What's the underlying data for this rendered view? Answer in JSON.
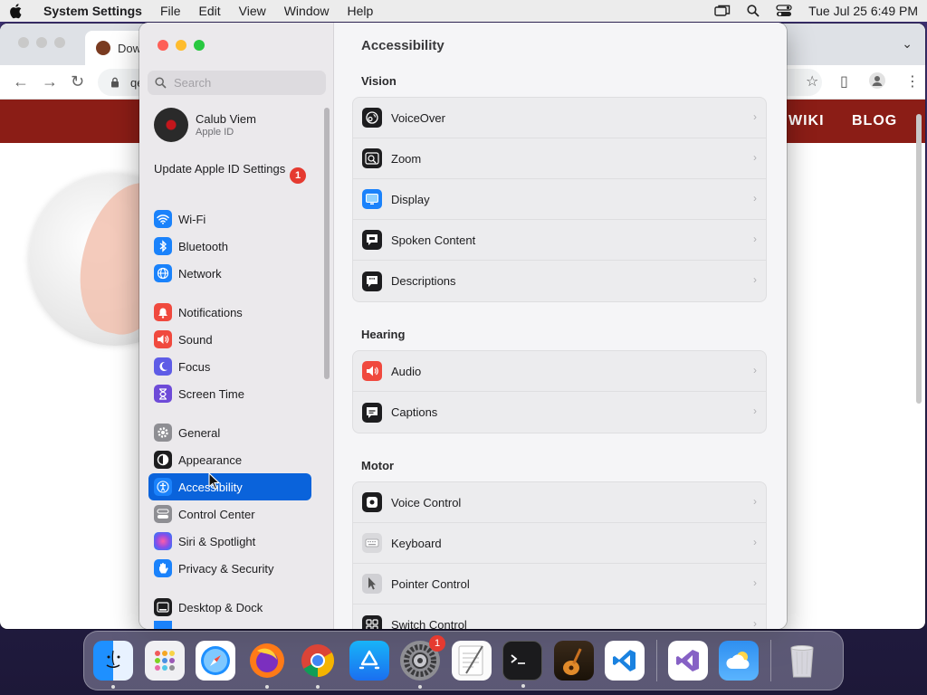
{
  "menubar": {
    "app_name": "System Settings",
    "menus": [
      "File",
      "Edit",
      "View",
      "Window",
      "Help"
    ],
    "clock": "Tue Jul 25  6:49 PM"
  },
  "browser": {
    "tab_title": "Dow",
    "url": "qe",
    "nav_links": [
      "WIKI",
      "BLOG"
    ]
  },
  "sidebar": {
    "search_placeholder": "Search",
    "user": {
      "name": "Calub Viem",
      "subtitle": "Apple ID"
    },
    "update": {
      "label": "Update Apple ID Settings",
      "badge": "1"
    },
    "items": [
      {
        "label": "Wi-Fi",
        "icon": "wifi-icon",
        "color": "#1a82fb"
      },
      {
        "label": "Bluetooth",
        "icon": "bluetooth-icon",
        "color": "#1a82fb"
      },
      {
        "label": "Network",
        "icon": "network-icon",
        "color": "#1a82fb"
      },
      {
        "label": "Notifications",
        "icon": "bell-icon",
        "color": "#f0493e"
      },
      {
        "label": "Sound",
        "icon": "speaker-icon",
        "color": "#f0493e"
      },
      {
        "label": "Focus",
        "icon": "moon-icon",
        "color": "#5e5ce6"
      },
      {
        "label": "Screen Time",
        "icon": "hourglass-icon",
        "color": "#6e4bd8"
      },
      {
        "label": "General",
        "icon": "gear-icon",
        "color": "#8e8e93"
      },
      {
        "label": "Appearance",
        "icon": "appearance-icon",
        "color": "#1d1d1f"
      },
      {
        "label": "Accessibility",
        "icon": "accessibility-icon",
        "color": "#1a82fb"
      },
      {
        "label": "Control Center",
        "icon": "control-center-icon",
        "color": "#8e8e93"
      },
      {
        "label": "Siri & Spotlight",
        "icon": "siri-icon",
        "color": "#b04fd6"
      },
      {
        "label": "Privacy & Security",
        "icon": "hand-icon",
        "color": "#1a82fb"
      },
      {
        "label": "Desktop & Dock",
        "icon": "dock-icon",
        "color": "#1d1d1f"
      }
    ],
    "selected": "Accessibility"
  },
  "main": {
    "title": "Accessibility",
    "sections": [
      {
        "title": "Vision",
        "rows": [
          {
            "label": "VoiceOver",
            "icon": "voiceover-icon"
          },
          {
            "label": "Zoom",
            "icon": "zoom-icon"
          },
          {
            "label": "Display",
            "icon": "display-icon"
          },
          {
            "label": "Spoken Content",
            "icon": "spoken-content-icon"
          },
          {
            "label": "Descriptions",
            "icon": "descriptions-icon"
          }
        ]
      },
      {
        "title": "Hearing",
        "rows": [
          {
            "label": "Audio",
            "icon": "audio-icon"
          },
          {
            "label": "Captions",
            "icon": "captions-icon"
          }
        ]
      },
      {
        "title": "Motor",
        "rows": [
          {
            "label": "Voice Control",
            "icon": "voice-control-icon"
          },
          {
            "label": "Keyboard",
            "icon": "keyboard-icon"
          },
          {
            "label": "Pointer Control",
            "icon": "pointer-control-icon"
          },
          {
            "label": "Switch Control",
            "icon": "switch-control-icon"
          }
        ]
      }
    ]
  },
  "dock": {
    "apps": [
      "finder-icon",
      "launchpad-icon",
      "safari-icon",
      "firefox-icon",
      "chrome-icon",
      "app-store-icon",
      "system-settings-icon",
      "textedit-icon",
      "terminal-icon",
      "garageband-icon",
      "vscode-icon",
      "visual-studio-icon",
      "weather-icon",
      "trash-icon"
    ],
    "system_settings_badge": "1"
  }
}
